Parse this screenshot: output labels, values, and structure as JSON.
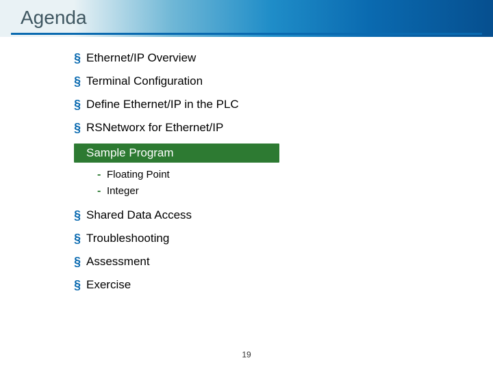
{
  "title": "Agenda",
  "items": [
    {
      "label": "Ethernet/IP Overview"
    },
    {
      "label": "Terminal Configuration"
    },
    {
      "label": "Define Ethernet/IP in the PLC"
    },
    {
      "label": "RSNetworx for Ethernet/IP"
    }
  ],
  "highlight": {
    "label": "Sample Program"
  },
  "subitems": [
    {
      "label": "Floating Point"
    },
    {
      "label": "Integer"
    }
  ],
  "items2": [
    {
      "label": "Shared Data Access"
    },
    {
      "label": "Troubleshooting"
    },
    {
      "label": "Assessment"
    },
    {
      "label": "Exercise"
    }
  ],
  "page_number": "19"
}
